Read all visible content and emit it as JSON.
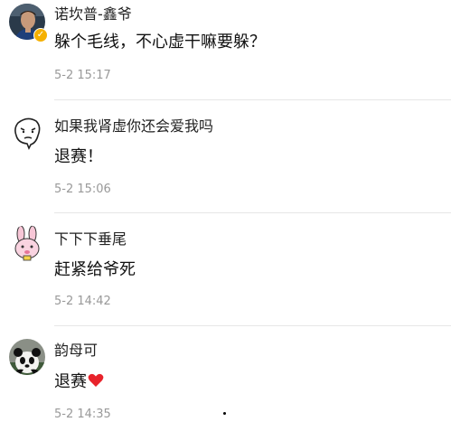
{
  "comments": [
    {
      "username": "诺坎普-鑫爷",
      "content": "躲个毛线，不心虚干嘛要躲？",
      "time": "5-2 15:17",
      "avatar_icon": "player-photo-avatar",
      "verified": true
    },
    {
      "username": "如果我肾虚你还会爱我吗",
      "content": "退赛！",
      "time": "5-2 15:06",
      "avatar_icon": "doodle-face-avatar"
    },
    {
      "username": "下下下垂尾",
      "content": "赶紧给爷死",
      "time": "5-2 14:42",
      "avatar_icon": "pink-bunny-avatar"
    },
    {
      "username": "韵母可",
      "content": "退赛",
      "content_emoji": "red-heart-icon",
      "time": "5-2 14:35",
      "avatar_icon": "panda-avatar"
    }
  ],
  "colors": {
    "time": "#999999",
    "divider": "#e6e6e6",
    "verified_badge": "#f5b000",
    "heart": "#e8232b"
  }
}
